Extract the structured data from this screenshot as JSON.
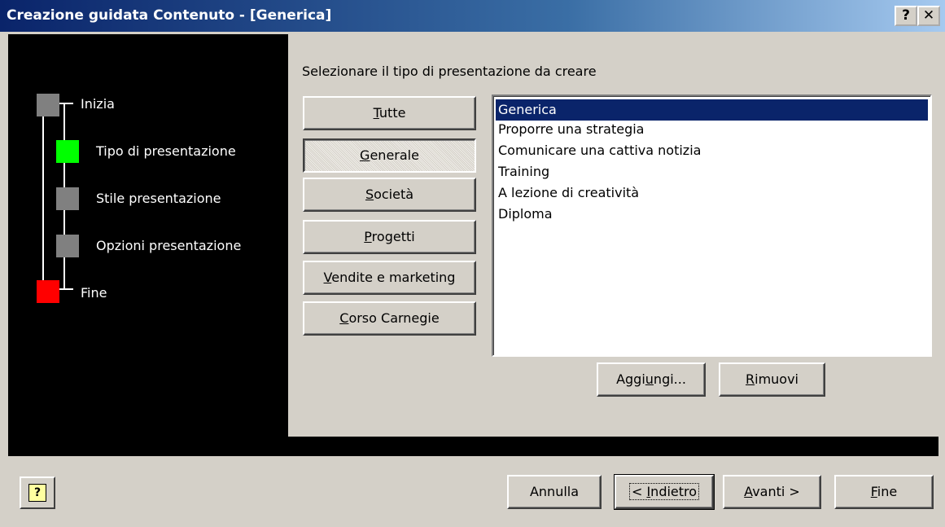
{
  "window": {
    "title": "Creazione guidata Contenuto - [Generica]",
    "help_glyph": "?",
    "close_glyph": "✕"
  },
  "steps": [
    {
      "label": "Inizia",
      "color": "#808080"
    },
    {
      "label": "Tipo di presentazione",
      "color": "#00ff00"
    },
    {
      "label": "Stile presentazione",
      "color": "#808080"
    },
    {
      "label": "Opzioni presentazione",
      "color": "#808080"
    },
    {
      "label": "Fine",
      "color": "#ff0000"
    }
  ],
  "main": {
    "prompt": "Selezionare il tipo di presentazione da creare",
    "categories": [
      {
        "label": "Tutte",
        "accel": "T",
        "rest": "utte"
      },
      {
        "label": "Generale",
        "accel": "G",
        "rest": "enerale",
        "selected": true
      },
      {
        "label": "Società",
        "accel": "S",
        "rest": "ocietà"
      },
      {
        "label": "Progetti",
        "accel": "P",
        "rest": "rogetti"
      },
      {
        "label": "Vendite e marketing",
        "accel": "V",
        "rest": "endite e marketing"
      },
      {
        "label": "Corso Carnegie",
        "accel": "C",
        "rest": "orso Carnegie"
      }
    ],
    "list_items": [
      "Generica",
      "Proporre una strategia",
      "Comunicare una cattiva notizia",
      "Training",
      "A lezione di creatività",
      "Diploma"
    ],
    "selected_item": "Generica",
    "add_button": {
      "pre": "Aggi",
      "accel": "u",
      "post": "ngi..."
    },
    "remove_button": {
      "accel": "R",
      "post": "imuovi"
    }
  },
  "footer": {
    "help_icon": "help-question-icon",
    "cancel": "Annulla",
    "back": {
      "pre": "< ",
      "accel": "I",
      "post": "ndietro"
    },
    "next": {
      "accel": "A",
      "post": "vanti >"
    },
    "finish": {
      "accel": "F",
      "post": "ine"
    }
  }
}
